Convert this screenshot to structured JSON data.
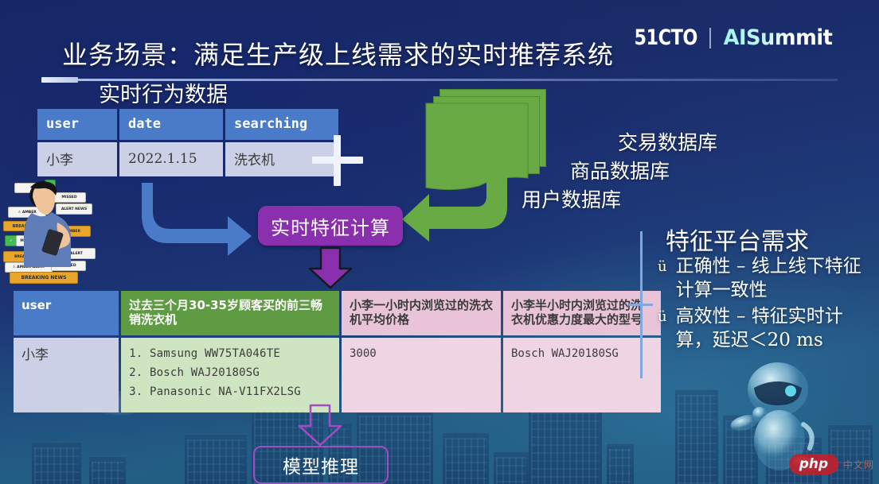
{
  "slide": {
    "title": "业务场景：满足生产级上线需求的实时推荐系统",
    "logo": {
      "left": "51CTO",
      "right": "AISummit",
      "divider": "|"
    },
    "watermark": {
      "badge": "php",
      "suffix": "中文网"
    }
  },
  "left": {
    "section_label": "实时行为数据",
    "plus_symbol": "+",
    "person_cards": [
      "BREAKING NEWS",
      "AMBER ALERT",
      "MISSED CALL",
      "NEWS",
      "BREAKING",
      "AMBER ALERT",
      "MISSED",
      "ALERT"
    ]
  },
  "behavior_table": {
    "headers": [
      "user",
      "date",
      "searching"
    ],
    "rows": [
      [
        "小李",
        "2022.1.15",
        "洗衣机"
      ]
    ]
  },
  "databases": {
    "items": [
      "交易数据库",
      "商品数据库",
      "用户数据库"
    ]
  },
  "compute_box": {
    "label": "实时特征计算"
  },
  "inference_box": {
    "label": "模型推理"
  },
  "feature_table": {
    "headers": [
      "user",
      "过去三个月30-35岁顾客买的前三畅销洗衣机",
      "小李一小时内浏览过的洗衣机平均价格",
      "小李半小时内浏览过的洗衣机优惠力度最大的型号"
    ],
    "row": {
      "user": "小李",
      "models": [
        "Samsung WW75TA046TE",
        "Bosch WAJ20180SG",
        "Panasonic NA-V11FX2LSG"
      ],
      "avg_price": "3000",
      "best_discount_model": "Bosch WAJ20180SG"
    }
  },
  "requirements": {
    "title": "特征平台需求",
    "bullet_glyph": "ü",
    "items": [
      "正确性 – 线上线下特征计算一致性",
      "高效性 – 特征实时计算，延迟＜20 ms"
    ]
  },
  "colors": {
    "background_deep": "#17275f",
    "background_teal": "#23527f",
    "header_blue": "#4a7bc8",
    "header_green": "#5f9b42",
    "header_pink": "#e9c4d8",
    "cell_blue": "#ccd0e6",
    "cell_green": "#cfe4c0",
    "cell_pink": "#efd5e4",
    "purple": "#8a2fae",
    "purple_outline": "#a24cc4",
    "arrow_blue": "#4a7bc8",
    "arrow_green": "#6aaa44",
    "accent_mint": "#9ff7e6",
    "watermark_red": "#c4202b"
  }
}
